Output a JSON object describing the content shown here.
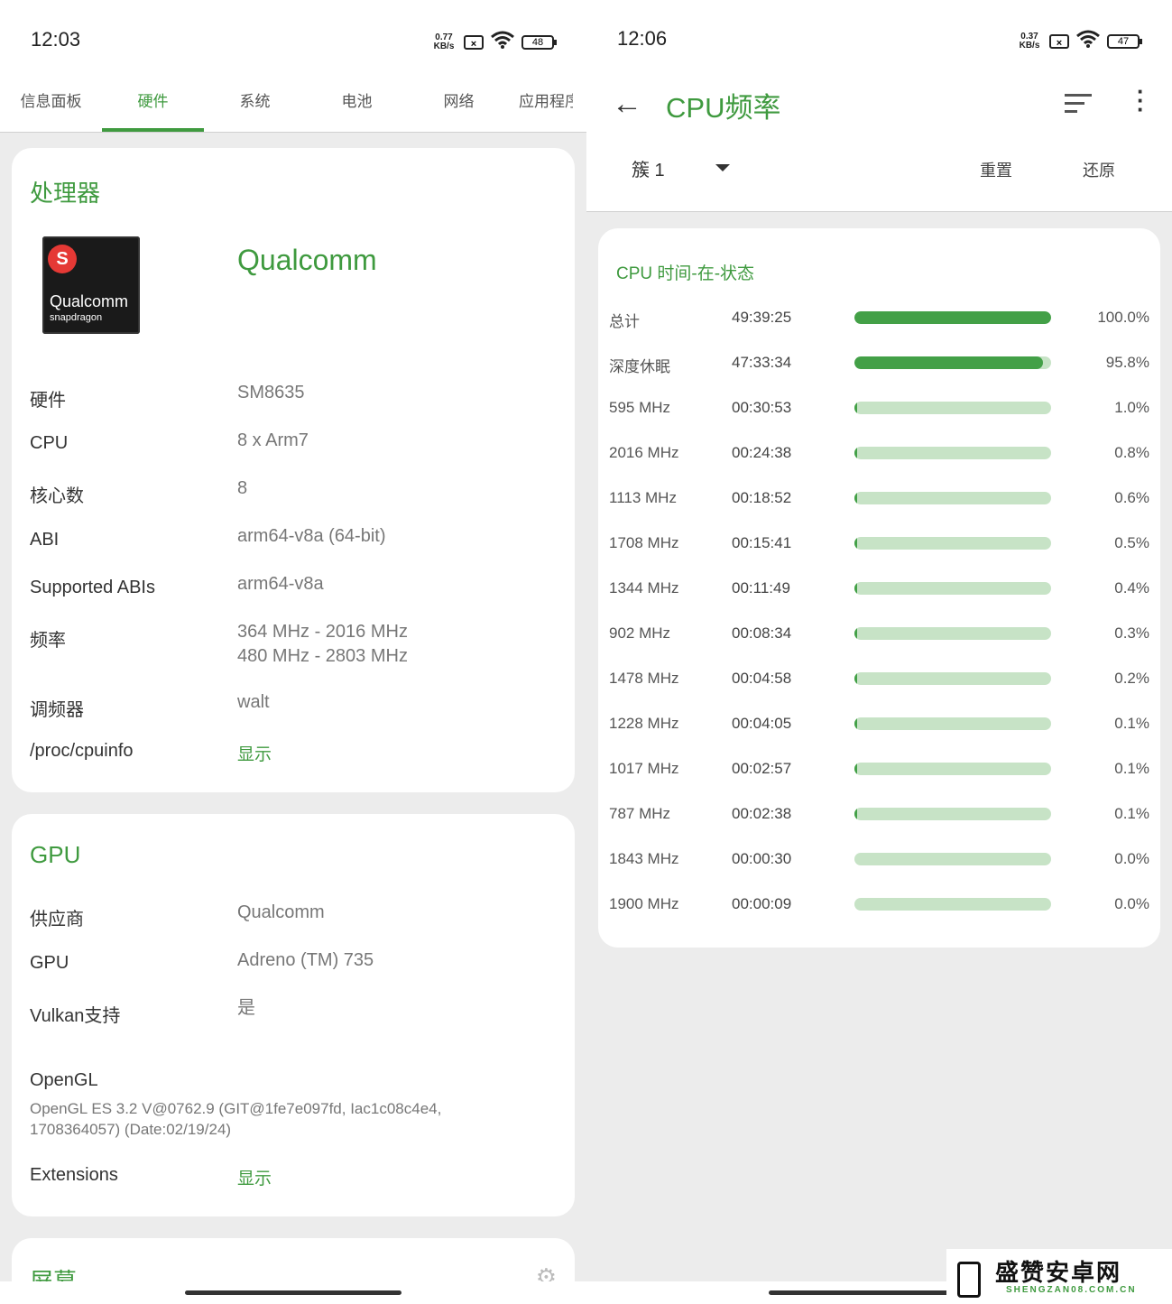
{
  "left": {
    "status": {
      "time": "12:03",
      "speed": "0.77 KB/s",
      "sim": "×",
      "battery": "48"
    },
    "tabs": [
      "信息面板",
      "硬件",
      "系统",
      "电池",
      "网络",
      "应用程序"
    ],
    "processor": {
      "title": "处理器",
      "vendor": "Qualcomm",
      "chip_brand": "Qualcomm",
      "chip_sub": "snapdragon",
      "rows": [
        {
          "label": "硬件",
          "value": "SM8635"
        },
        {
          "label": "CPU",
          "value": "8 x Arm7"
        },
        {
          "label": "核心数",
          "value": "8"
        },
        {
          "label": "ABI",
          "value": "arm64-v8a (64-bit)"
        },
        {
          "label": "Supported ABIs",
          "value": "arm64-v8a"
        },
        {
          "label": "频率",
          "value": "364 MHz - 2016 MHz",
          "value2": "480 MHz - 2803 MHz"
        },
        {
          "label": "调频器",
          "value": "walt"
        },
        {
          "label": "/proc/cpuinfo",
          "value": "显示"
        }
      ]
    },
    "gpu": {
      "title": "GPU",
      "rows": [
        {
          "label": "供应商",
          "value": "Qualcomm"
        },
        {
          "label": "GPU",
          "value": "Adreno (TM) 735"
        },
        {
          "label": "Vulkan支持",
          "value": "是"
        }
      ],
      "opengl_label": "OpenGL",
      "opengl_value": "OpenGL ES 3.2 V@0762.9 (GIT@1fe7e097fd, Iac1c08c4e4, 1708364057) (Date:02/19/24)",
      "extensions_label": "Extensions",
      "extensions_value": "显示"
    },
    "screen": {
      "title": "屏幕"
    }
  },
  "right": {
    "status": {
      "time": "12:06",
      "speed": "0.37 KB/s",
      "sim": "×",
      "battery": "47"
    },
    "title": "CPU频率",
    "cluster": "簇 1",
    "reset": "重置",
    "restore": "还原",
    "card_title": "CPU 时间-在-状态",
    "states": [
      {
        "name": "总计",
        "time": "49:39:25",
        "pct": "100.0%",
        "fraction": 1.0,
        "dark": true
      },
      {
        "name": "深度休眠",
        "time": "47:33:34",
        "pct": "95.8%",
        "fraction": 0.958,
        "dark": true
      },
      {
        "name": "595 MHz",
        "time": "00:30:53",
        "pct": "1.0%",
        "fraction": 0.01,
        "dark": false
      },
      {
        "name": "2016 MHz",
        "time": "00:24:38",
        "pct": "0.8%",
        "fraction": 0.008,
        "dark": false
      },
      {
        "name": "1113 MHz",
        "time": "00:18:52",
        "pct": "0.6%",
        "fraction": 0.006,
        "dark": false
      },
      {
        "name": "1708 MHz",
        "time": "00:15:41",
        "pct": "0.5%",
        "fraction": 0.005,
        "dark": false
      },
      {
        "name": "1344 MHz",
        "time": "00:11:49",
        "pct": "0.4%",
        "fraction": 0.004,
        "dark": false
      },
      {
        "name": "902 MHz",
        "time": "00:08:34",
        "pct": "0.3%",
        "fraction": 0.003,
        "dark": false
      },
      {
        "name": "1478 MHz",
        "time": "00:04:58",
        "pct": "0.2%",
        "fraction": 0.002,
        "dark": false
      },
      {
        "name": "1228 MHz",
        "time": "00:04:05",
        "pct": "0.1%",
        "fraction": 0.001,
        "dark": false
      },
      {
        "name": "1017 MHz",
        "time": "00:02:57",
        "pct": "0.1%",
        "fraction": 0.001,
        "dark": false
      },
      {
        "name": "787 MHz",
        "time": "00:02:38",
        "pct": "0.1%",
        "fraction": 0.001,
        "dark": false
      },
      {
        "name": "1843 MHz",
        "time": "00:00:30",
        "pct": "0.0%",
        "fraction": 0.0,
        "dark": false
      },
      {
        "name": "1900 MHz",
        "time": "00:00:09",
        "pct": "0.0%",
        "fraction": 0.0,
        "dark": false
      }
    ]
  },
  "watermark": {
    "text": "盛赞安卓网",
    "url": "SHENGZAN08.COM.CN"
  },
  "colors": {
    "accent": "#3f9a3f",
    "bar_track": "#c7e3c6",
    "bar_fill": "#43a047"
  }
}
